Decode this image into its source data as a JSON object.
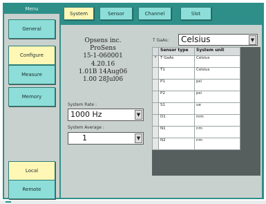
{
  "menu": {
    "title": "Menu",
    "items": [
      {
        "label": "General"
      },
      {
        "label": "Configure"
      },
      {
        "label": "Measure"
      },
      {
        "label": "Memory"
      }
    ],
    "bottom_items": [
      {
        "label": "Local"
      },
      {
        "label": "Remote"
      }
    ]
  },
  "tabs": [
    {
      "label": "System"
    },
    {
      "label": "Sensor"
    },
    {
      "label": "Channel"
    },
    {
      "label": "Slot"
    }
  ],
  "system_info": {
    "company": "Opsens inc.",
    "product": "ProSens",
    "serial": "15-1-060001",
    "version": "4.20.16",
    "build1": "1.01B 14Aug06",
    "build2": "1.00 28Jul06"
  },
  "system_rate": {
    "label": "System Rate :",
    "value": "1000 Hz"
  },
  "system_average": {
    "label": "System Average :",
    "value": "1"
  },
  "t_gaas": {
    "label": "T GaAs:",
    "value": "Celsius"
  },
  "sensor_table": {
    "headers": [
      "Sensor type",
      "System unit"
    ],
    "row_marker": "*",
    "rows": [
      {
        "type": "T GaAs",
        "unit": "Celsius"
      },
      {
        "type": "T1",
        "unit": "Celsius"
      },
      {
        "type": "P1",
        "unit": "psi"
      },
      {
        "type": "P2",
        "unit": "psi"
      },
      {
        "type": "S1",
        "unit": "ue"
      },
      {
        "type": "D1",
        "unit": "mm"
      },
      {
        "type": "N1",
        "unit": "nm"
      },
      {
        "type": "N2",
        "unit": "nm"
      }
    ]
  },
  "colors": {
    "accent": "#2e8f89",
    "button": "#8dded8",
    "active": "#fff7b5",
    "panel": "#c9d1ce"
  }
}
